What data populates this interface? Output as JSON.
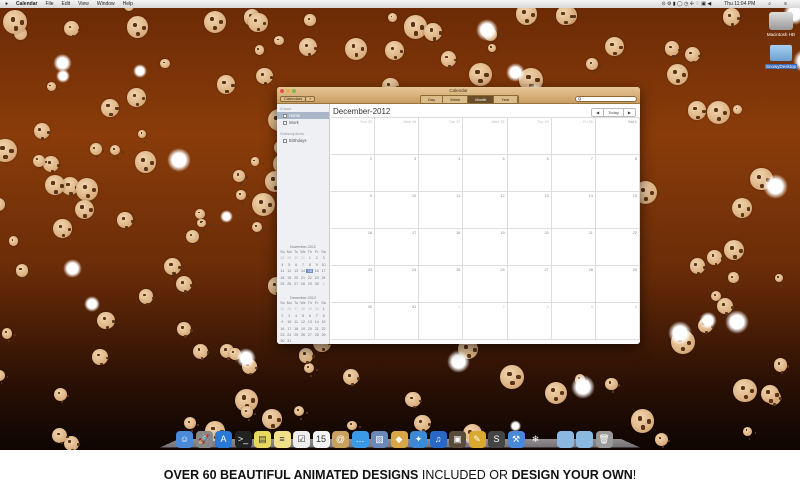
{
  "menubar": {
    "app": "Calendar",
    "items": [
      "File",
      "Edit",
      "View",
      "Window",
      "Help"
    ],
    "clock": "Thu 11:04 PM"
  },
  "desktop_icons": [
    {
      "label": "Macintosh HD"
    },
    {
      "label": "SnowyDesktop"
    }
  ],
  "window": {
    "title": "Calendar",
    "calendars_button": "Calendars",
    "add_button": "+",
    "views": [
      "Day",
      "Week",
      "Month",
      "Year"
    ],
    "active_view": "Month",
    "search_placeholder": "Q",
    "sidebar": {
      "icloud_header": "iCloud",
      "calendars": [
        {
          "label": "Home",
          "selected": true
        },
        {
          "label": "Work",
          "selected": false
        }
      ],
      "subs_header": "Subscriptions",
      "subscriptions": [
        {
          "label": "Birthdays"
        }
      ]
    },
    "month_title": "December-2012",
    "nav": {
      "prev": "◀",
      "today": "Today",
      "next": "▶"
    },
    "grid": [
      [
        "Sun 25",
        "Mon 26",
        "Tue 27",
        "Wed 28",
        "Thu 29",
        "Fri 30",
        "Sat 1"
      ],
      [
        "2",
        "3",
        "4",
        "5",
        "6",
        "7",
        "8"
      ],
      [
        "9",
        "10",
        "11",
        "12",
        "13",
        "14",
        "15"
      ],
      [
        "16",
        "17",
        "18",
        "19",
        "20",
        "21",
        "22"
      ],
      [
        "23",
        "24",
        "25",
        "26",
        "27",
        "28",
        "29"
      ],
      [
        "30",
        "31",
        "1",
        "2",
        "3",
        "4",
        "5"
      ]
    ],
    "mini_calendars": [
      {
        "title": "November-2012",
        "days": [
          "Su",
          "Mo",
          "Tu",
          "We",
          "Th",
          "Fr",
          "Sa"
        ],
        "dates": [
          "28",
          "29",
          "30",
          "31",
          "1",
          "2",
          "3",
          "4",
          "5",
          "6",
          "7",
          "8",
          "9",
          "10",
          "11",
          "12",
          "13",
          "14",
          "15",
          "16",
          "17",
          "18",
          "19",
          "20",
          "21",
          "22",
          "23",
          "24",
          "25",
          "26",
          "27",
          "28",
          "29",
          "30",
          "1"
        ],
        "today": "15"
      },
      {
        "title": "December-2012",
        "days": [
          "Su",
          "Mo",
          "Tu",
          "We",
          "Th",
          "Fr",
          "Sa"
        ],
        "dates": [
          "25",
          "26",
          "27",
          "28",
          "29",
          "30",
          "1",
          "2",
          "3",
          "4",
          "5",
          "6",
          "7",
          "8",
          "9",
          "10",
          "11",
          "12",
          "13",
          "14",
          "15",
          "16",
          "17",
          "18",
          "19",
          "20",
          "21",
          "22",
          "23",
          "24",
          "25",
          "26",
          "27",
          "28",
          "29",
          "30",
          "31"
        ]
      }
    ]
  },
  "dock": [
    {
      "name": "finder",
      "glyph": "☺",
      "color": "#4a8ad8"
    },
    {
      "name": "launchpad",
      "glyph": "🚀",
      "color": "#888"
    },
    {
      "name": "app-store",
      "glyph": "A",
      "color": "#2a78d8"
    },
    {
      "name": "terminal",
      "glyph": ">_",
      "color": "#222"
    },
    {
      "name": "stickies",
      "glyph": "▤",
      "color": "#e8d860"
    },
    {
      "name": "notes",
      "glyph": "≡",
      "color": "#f0e08a"
    },
    {
      "name": "reminders",
      "glyph": "☑",
      "color": "#eee"
    },
    {
      "name": "calendar",
      "glyph": "15",
      "color": "#f4f4f4"
    },
    {
      "name": "contacts",
      "glyph": "@",
      "color": "#c8a060"
    },
    {
      "name": "messages",
      "glyph": "…",
      "color": "#3a9ae8"
    },
    {
      "name": "preview",
      "glyph": "▨",
      "color": "#6a88b8"
    },
    {
      "name": "archive",
      "glyph": "◆",
      "color": "#d8a848"
    },
    {
      "name": "safari",
      "glyph": "✦",
      "color": "#3a8ad8"
    },
    {
      "name": "itunes",
      "glyph": "♫",
      "color": "#2a68c8"
    },
    {
      "name": "photo-booth",
      "glyph": "▣",
      "color": "#5a4a3a"
    },
    {
      "name": "iphoto",
      "glyph": "✎",
      "color": "#d8a830"
    },
    {
      "name": "sublime",
      "glyph": "S",
      "color": "#444"
    },
    {
      "name": "xcode",
      "glyph": "⚒",
      "color": "#4a88d8"
    },
    {
      "name": "snowy",
      "glyph": "❄",
      "color": "transparent"
    },
    {
      "name": "applications-folder",
      "glyph": "",
      "color": "#8ab8e0"
    },
    {
      "name": "documents-folder",
      "glyph": "",
      "color": "#8ab8e0"
    },
    {
      "name": "trash",
      "glyph": "🗑",
      "color": "#999"
    }
  ],
  "caption": {
    "part1": "OVER 60 BEAUTIFUL ANIMATED DESIGNS",
    "part2": " INCLUDED OR ",
    "part3": "DESIGN YOUR OWN",
    "part4": "!"
  }
}
